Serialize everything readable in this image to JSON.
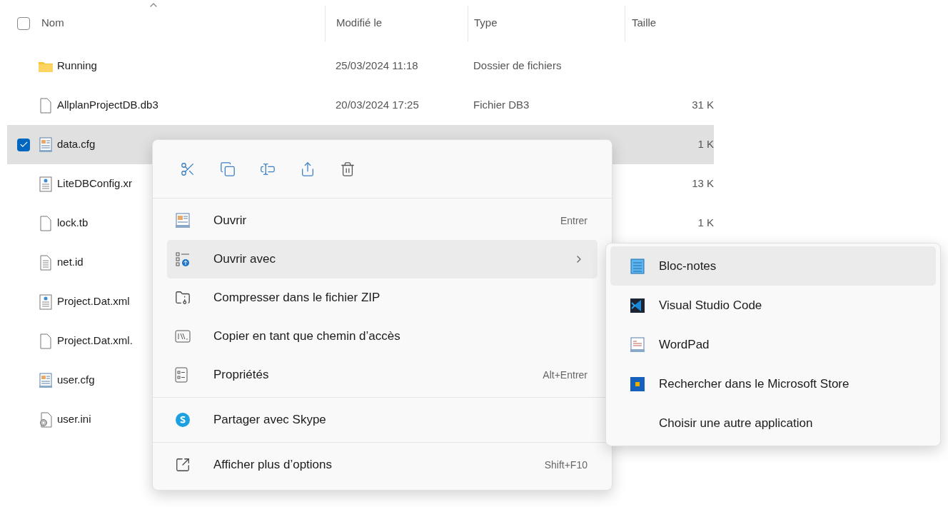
{
  "header": {
    "checked": false,
    "columns": [
      "Nom",
      "Modifié le",
      "Type",
      "Taille"
    ]
  },
  "files": [
    {
      "name": "Running",
      "kind": "folder",
      "modified": "25/03/2024 11:18",
      "type": "Dossier de fichiers",
      "selected": false
    },
    {
      "name": "AllplanProjectDB.db3",
      "kind": "file",
      "modified": "20/03/2024 17:25",
      "type": "Fichier DB3",
      "size": "31 K",
      "selected": false
    },
    {
      "name": "data.cfg",
      "kind": "cfg",
      "size": "1 K",
      "selected": true
    },
    {
      "name": "LiteDBConfig.xr",
      "kind": "xml",
      "size": "13 K",
      "selected": false
    },
    {
      "name": "lock.tb",
      "kind": "file",
      "size": "1 K",
      "selected": false
    },
    {
      "name": "net.id",
      "kind": "text",
      "selected": false
    },
    {
      "name": "Project.Dat.xml",
      "kind": "xml",
      "selected": false
    },
    {
      "name": "Project.Dat.xml.",
      "kind": "file",
      "selected": false
    },
    {
      "name": "user.cfg",
      "kind": "cfg",
      "selected": false
    },
    {
      "name": "user.ini",
      "kind": "ini",
      "selected": false
    }
  ],
  "context_menu": {
    "sections": [
      [
        {
          "label": "Ouvrir",
          "kind": "app",
          "shortcut": "Entrer",
          "selected": false
        },
        {
          "label": "Ouvrir avec",
          "kind": "openwith",
          "has_submenu": true,
          "selected": true
        },
        {
          "label": "Compresser dans le fichier ZIP",
          "kind": "zip",
          "selected": false
        },
        {
          "label": "Copier en tant que chemin d’accès",
          "kind": "path",
          "selected": false
        },
        {
          "label": "Propriétés",
          "kind": "props",
          "shortcut": "Alt+Entrer",
          "selected": false
        }
      ],
      [
        {
          "label": "Partager avec Skype",
          "kind": "skype",
          "selected": false
        }
      ],
      [
        {
          "label": "Afficher plus d’options",
          "kind": "more",
          "shortcut": "Shift+F10",
          "selected": false
        }
      ]
    ]
  },
  "submenu": {
    "items": [
      {
        "label": "Bloc-notes",
        "kind": "notepad",
        "selected": true
      },
      {
        "label": "Visual Studio Code",
        "kind": "vscode",
        "selected": false
      },
      {
        "label": "WordPad",
        "kind": "wordpad",
        "selected": false
      },
      {
        "label": "Rechercher dans le Microsoft Store",
        "kind": "store",
        "selected": false
      },
      {
        "label": "Choisir une autre application",
        "kind": "none",
        "selected": false
      }
    ]
  }
}
